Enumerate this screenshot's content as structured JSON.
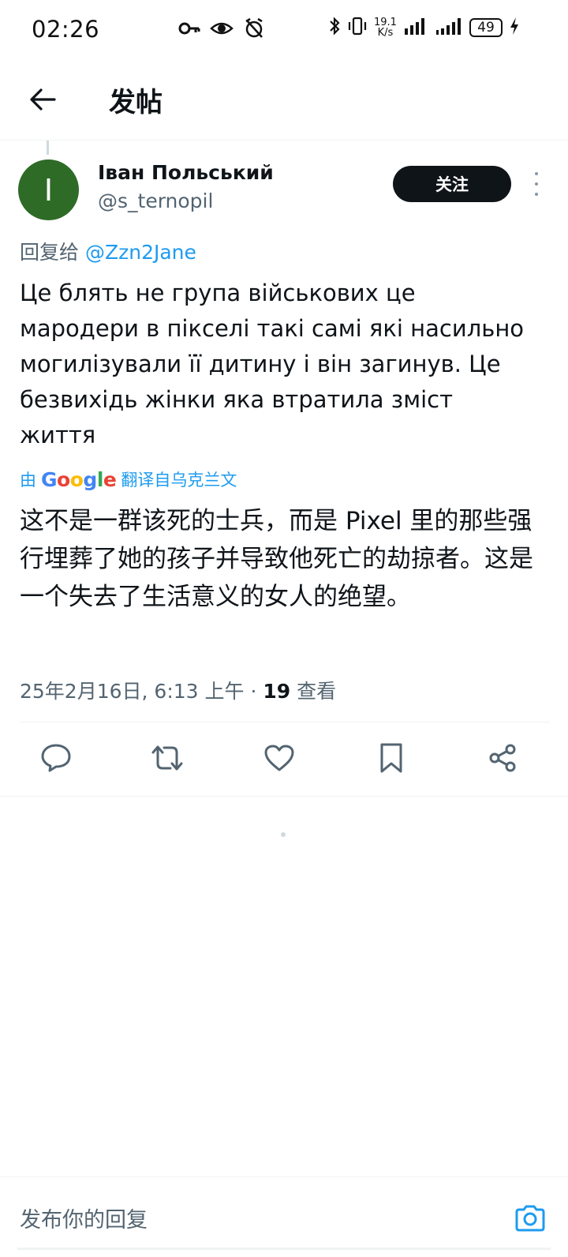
{
  "status_bar": {
    "time": "02:26",
    "speed_value": "19.1",
    "speed_unit": "K/s",
    "battery": "49"
  },
  "header": {
    "title": "发帖"
  },
  "tweet": {
    "author_initial": "I",
    "author_name": "Іван Польський",
    "author_handle": "@s_ternopil",
    "follow_label": "关注",
    "reply_prefix": "回复给",
    "reply_mention": "@Zzn2Jane",
    "text": "Це блять не група військових це мародери в пікселі такі самі які насильно могилізували її дитину і він загинув. Це безвихідь жінки яка втратила зміст життя",
    "translated_by_prefix": "由",
    "translated_by_brand": "Google",
    "translated_by_suffix": "翻译自乌克兰文",
    "translated_text": "这不是一群该死的士兵，而是 Pixel 里的那些强行埋葬了她的孩子并导致他死亡的劫掠者。这是一个失去了生活意义的女人的绝望。",
    "date_time": "25年2月16日, 6:13 上午 · ",
    "views_count": "19",
    "views_label": " 查看"
  },
  "actions": [
    {
      "icon": "reply-icon"
    },
    {
      "icon": "retweet-icon"
    },
    {
      "icon": "like-icon"
    },
    {
      "icon": "bookmark-icon"
    },
    {
      "icon": "share-icon"
    }
  ],
  "reply_bar": {
    "placeholder": "发布你的回复"
  },
  "colors": {
    "accent": "#1d9bf0",
    "avatar_bg": "#2e6b27",
    "follow_bg": "#0f1419",
    "secondary_text": "#536471"
  }
}
